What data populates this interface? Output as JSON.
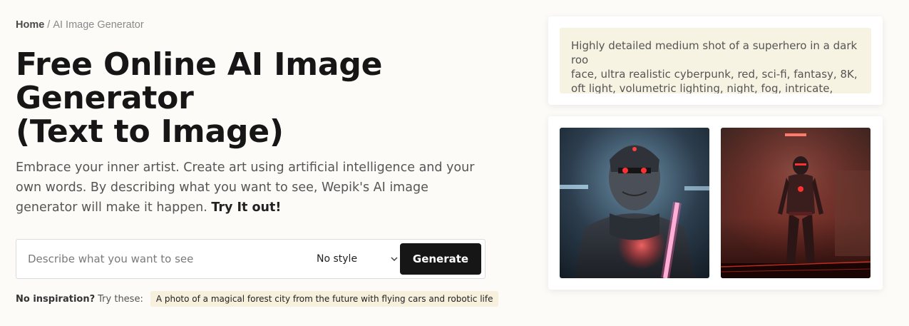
{
  "breadcrumb": {
    "home": "Home",
    "separator": "/",
    "current": "AI Image Generator"
  },
  "title": {
    "line1": "Free Online AI Image",
    "line2": "Generator",
    "line3": "(Text to Image)"
  },
  "description": {
    "text": "Embrace your inner artist. Create art using artificial intelligence and your own words. By describing what you want to see, Wepik's AI image generator will make it happen.",
    "cta": "Try It out!"
  },
  "generator": {
    "placeholder": "Describe what you want to see",
    "style_value": "No style",
    "button_label": "Generate"
  },
  "inspiration": {
    "label": "No inspiration?",
    "try_label": "Try these:",
    "chip": "A photo of a magical forest city from the future with flying cars and robotic life"
  },
  "example_prompt": {
    "text": "Highly detailed medium shot of a superhero in a dark roo\nface, ultra realistic cyberpunk, red, sci-fi, fantasy, 8K,\noft light, volumetric lighting, night, fog, intricate, elegant"
  },
  "colors": {
    "background": "#fcfbf8",
    "button": "#161616",
    "prompt_bg": "#f7f3e3",
    "chip_bg": "#f6f0dc"
  }
}
